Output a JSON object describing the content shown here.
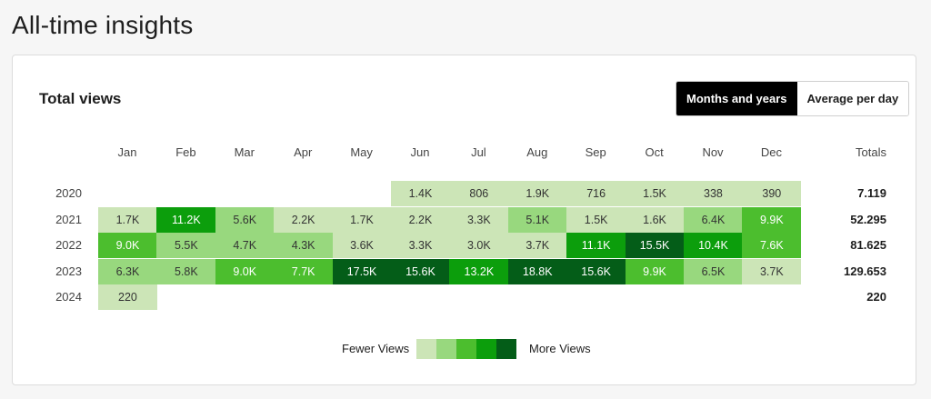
{
  "page": {
    "title": "All-time insights"
  },
  "card": {
    "title": "Total views",
    "toggle": {
      "active": "Months and years",
      "inactive": "Average per day"
    },
    "totals_label": "Totals"
  },
  "legend": {
    "fewer": "Fewer Views",
    "more": "More Views",
    "colors": [
      "#cce5b7",
      "#98d87e",
      "#4cbe2e",
      "#0c9e0c",
      "#045d18"
    ]
  },
  "months": [
    "Jan",
    "Feb",
    "Mar",
    "Apr",
    "May",
    "Jun",
    "Jul",
    "Aug",
    "Sep",
    "Oct",
    "Nov",
    "Dec"
  ],
  "chart_data": {
    "type": "heatmap",
    "x_categories": [
      "Jan",
      "Feb",
      "Mar",
      "Apr",
      "May",
      "Jun",
      "Jul",
      "Aug",
      "Sep",
      "Oct",
      "Nov",
      "Dec"
    ],
    "rows": [
      {
        "year": "2020",
        "total": "7.119",
        "cells": [
          "",
          "",
          "",
          "",
          "",
          "1.4K",
          "806",
          "1.9K",
          "716",
          "1.5K",
          "338",
          "390"
        ],
        "levels": [
          0,
          0,
          0,
          0,
          0,
          1,
          1,
          1,
          1,
          1,
          1,
          1
        ]
      },
      {
        "year": "2021",
        "total": "52.295",
        "cells": [
          "1.7K",
          "11.2K",
          "5.6K",
          "2.2K",
          "1.7K",
          "2.2K",
          "3.3K",
          "5.1K",
          "1.5K",
          "1.6K",
          "6.4K",
          "9.9K"
        ],
        "levels": [
          1,
          4,
          2,
          1,
          1,
          1,
          1,
          2,
          1,
          1,
          2,
          3
        ]
      },
      {
        "year": "2022",
        "total": "81.625",
        "cells": [
          "9.0K",
          "5.5K",
          "4.7K",
          "4.3K",
          "3.6K",
          "3.3K",
          "3.0K",
          "3.7K",
          "11.1K",
          "15.5K",
          "10.4K",
          "7.6K"
        ],
        "levels": [
          3,
          2,
          2,
          2,
          1,
          1,
          1,
          1,
          4,
          5,
          4,
          3
        ]
      },
      {
        "year": "2023",
        "total": "129.653",
        "cells": [
          "6.3K",
          "5.8K",
          "9.0K",
          "7.7K",
          "17.5K",
          "15.6K",
          "13.2K",
          "18.8K",
          "15.6K",
          "9.9K",
          "6.5K",
          "3.7K"
        ],
        "levels": [
          2,
          2,
          3,
          3,
          5,
          5,
          4,
          5,
          5,
          3,
          2,
          1
        ]
      },
      {
        "year": "2024",
        "total": "220",
        "cells": [
          "220",
          "",
          "",
          "",
          "",
          "",
          "",
          "",
          "",
          "",
          "",
          ""
        ],
        "levels": [
          1,
          0,
          0,
          0,
          0,
          0,
          0,
          0,
          0,
          0,
          0,
          0
        ]
      }
    ]
  }
}
